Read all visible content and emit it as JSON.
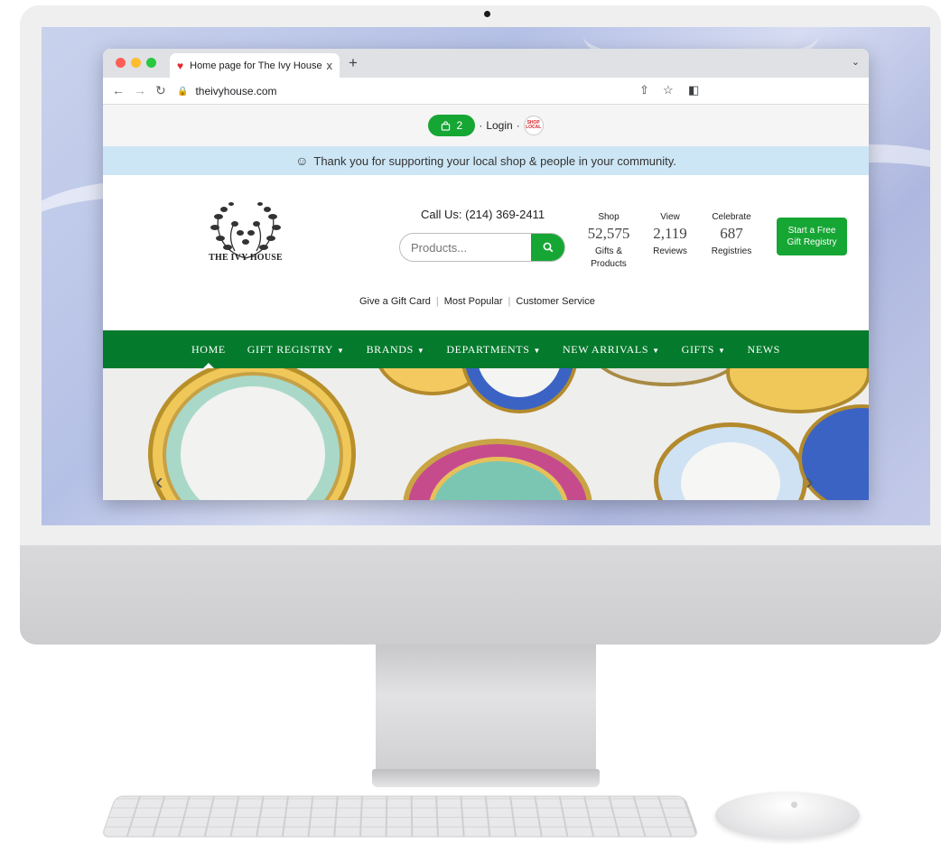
{
  "browser": {
    "tab_title": "Home page for The Ivy House",
    "tab_close": "x",
    "new_tab": "+",
    "url": "theivyhouse.com"
  },
  "site": {
    "cart_count": "2",
    "login": "Login",
    "shop_local_badge": "SHOP LOCAL",
    "banner_text": "Thank you for supporting your local shop & people in your community.",
    "logo_text": "THE IVY HOUSE",
    "call_us": "Call Us: (214) 369-2411",
    "search_placeholder": "Products...",
    "stats": [
      {
        "top": "Shop",
        "number": "52,575",
        "bottom": "Gifts & Products"
      },
      {
        "top": "View",
        "number": "2,119",
        "bottom": "Reviews"
      },
      {
        "top": "Celebrate",
        "number": "687",
        "bottom": "Registries"
      }
    ],
    "cta": "Start a Free Gift Registry",
    "links": [
      "Give a Gift Card",
      "Most Popular",
      "Customer Service"
    ],
    "nav": [
      {
        "label": "HOME"
      },
      {
        "label": "GIFT REGISTRY"
      },
      {
        "label": "BRANDS"
      },
      {
        "label": "DEPARTMENTS"
      },
      {
        "label": "NEW ARRIVALS"
      },
      {
        "label": "GIFTS"
      },
      {
        "label": "NEWS"
      }
    ]
  },
  "icons": {
    "cart": "shopping-bag-icon",
    "search": "search-icon",
    "smile": "smile-icon",
    "heart": "heart-icon"
  },
  "colors": {
    "brand_green": "#16a634",
    "nav_green": "#047a2c",
    "banner_blue": "#cde6f5"
  }
}
